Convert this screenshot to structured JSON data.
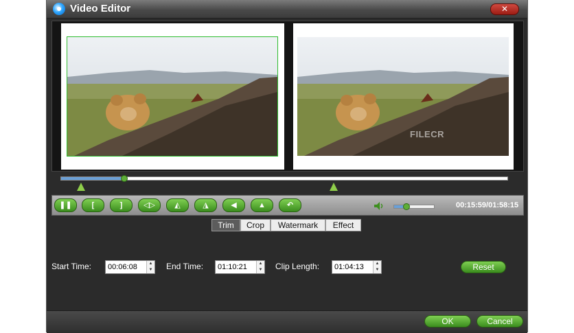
{
  "window": {
    "title": "Video Editor",
    "close_label": "✕"
  },
  "preview": {
    "watermark_text": "FILECR"
  },
  "timeline": {
    "progress": 0.14
  },
  "toolbar": {
    "buttons": [
      {
        "name": "pause-button",
        "glyph": "❚❚"
      },
      {
        "name": "set-start-button",
        "glyph": "["
      },
      {
        "name": "set-end-button",
        "glyph": "]"
      },
      {
        "name": "play-segment-button",
        "glyph": "◁▷"
      },
      {
        "name": "rotate-left-button",
        "glyph": "◭"
      },
      {
        "name": "rotate-right-button",
        "glyph": "◮"
      },
      {
        "name": "flip-horizontal-button",
        "glyph": "◀"
      },
      {
        "name": "flip-vertical-button",
        "glyph": "▲"
      },
      {
        "name": "undo-button",
        "glyph": "↶"
      }
    ],
    "volume_level": 0.3,
    "time_readout": "00:15:59/01:58:15"
  },
  "tabs": [
    {
      "label": "Trim",
      "active": true
    },
    {
      "label": "Crop",
      "active": false
    },
    {
      "label": "Watermark",
      "active": false
    },
    {
      "label": "Effect",
      "active": false
    }
  ],
  "trim": {
    "start_label": "Start Time:",
    "start_value": "00:06:08",
    "end_label": "End Time:",
    "end_value": "01:10:21",
    "clip_label": "Clip Length:",
    "clip_value": "01:04:13",
    "reset_label": "Reset"
  },
  "footer": {
    "ok_label": "OK",
    "cancel_label": "Cancel"
  },
  "colors": {
    "accent_green": "#4fa52a",
    "window_bg": "#2b2b2b"
  }
}
